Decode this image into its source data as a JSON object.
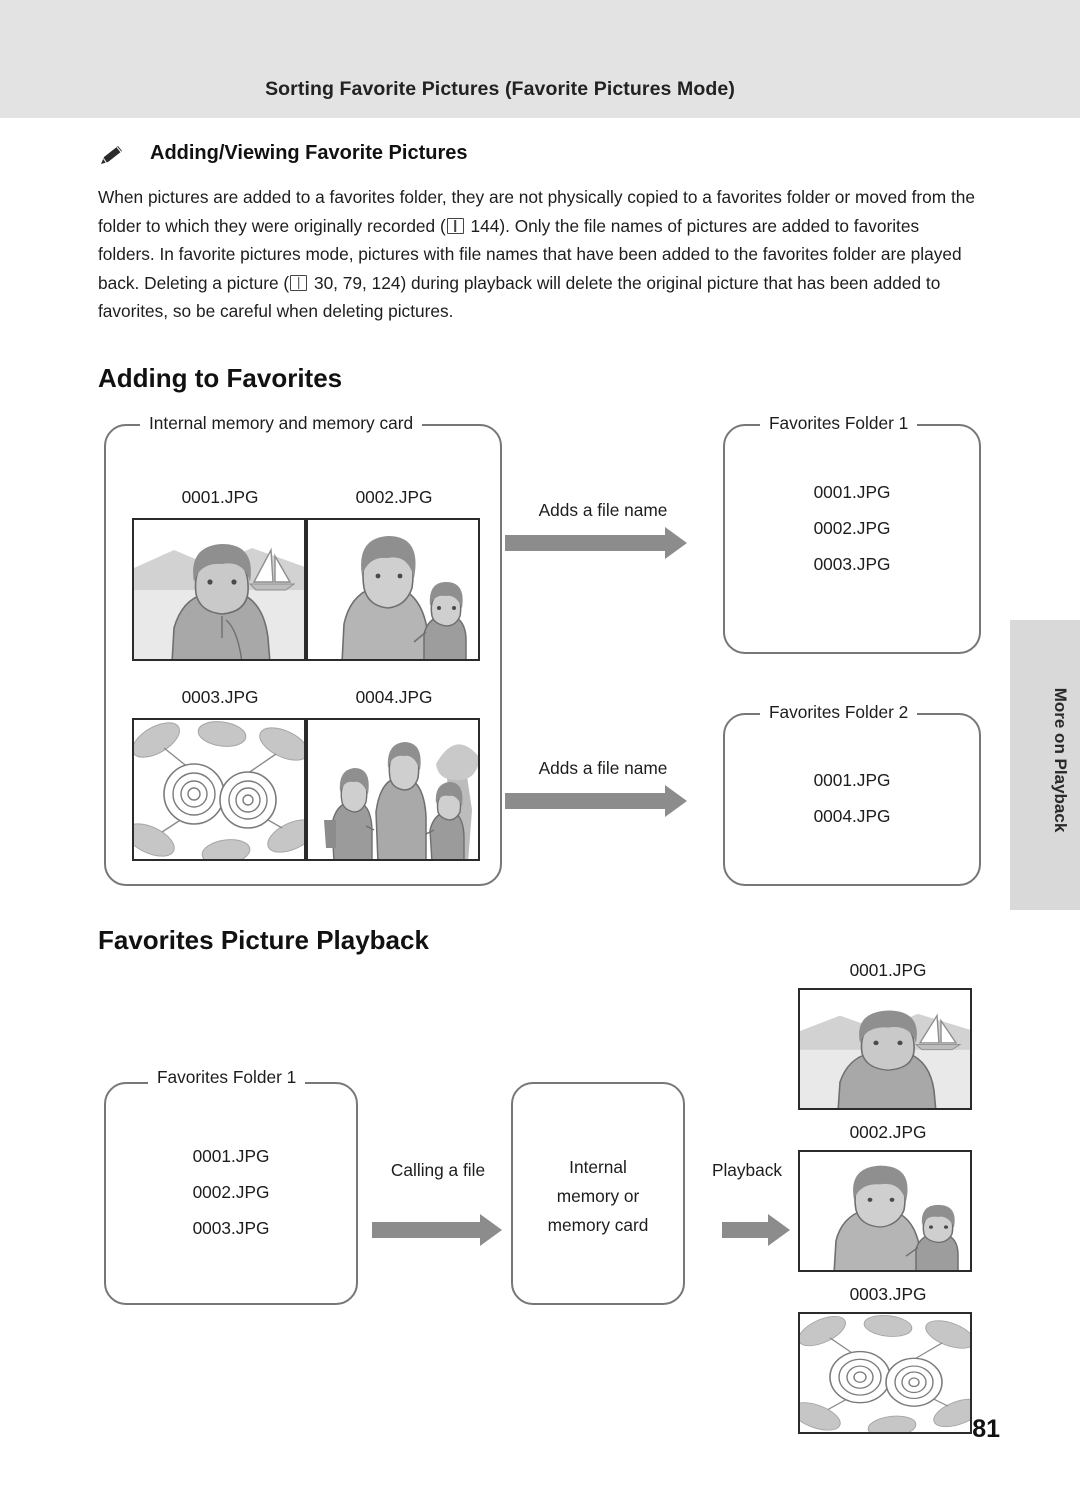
{
  "header": {
    "title": "Sorting Favorite Pictures (Favorite Pictures Mode)"
  },
  "side_tab": {
    "label": "More on Playback"
  },
  "note": {
    "icon": "pencil-note-icon",
    "title": "Adding/Viewing Favorite Pictures",
    "body_part1": "When pictures are added to a favorites folder, they are not physically copied to a favorites folder or moved from the folder to which they were originally recorded (",
    "body_ref1": " 144). Only the file names of pictures are added to favorites folders. In favorite pictures mode, pictures with file names that have been added to the favorites folder are played back. Deleting a picture (",
    "body_ref2": " 30, 79, 124) during playback will delete the original picture that has been added to favorites, so be careful when deleting pictures."
  },
  "sections": {
    "adding": "Adding to Favorites",
    "playback": "Favorites Picture Playback"
  },
  "adding_diagram": {
    "source_box_label": "Internal memory and memory card",
    "source_files": [
      "0001.JPG",
      "0002.JPG",
      "0003.JPG",
      "0004.JPG"
    ],
    "arrow1_caption": "Adds a file name",
    "arrow2_caption": "Adds a file name",
    "folder1_label": "Favorites Folder 1",
    "folder1_files": [
      "0001.JPG",
      "0002.JPG",
      "0003.JPG"
    ],
    "folder2_label": "Favorites Folder 2",
    "folder2_files": [
      "0001.JPG",
      "0004.JPG"
    ]
  },
  "playback_diagram": {
    "folder_label": "Favorites Folder 1",
    "folder_files": [
      "0001.JPG",
      "0002.JPG",
      "0003.JPG"
    ],
    "arrow1_caption": "Calling a file",
    "memory_box_label": "Internal\nmemory or\nmemory card",
    "arrow2_caption": "Playback",
    "output_files": [
      "0001.JPG",
      "0002.JPG",
      "0003.JPG"
    ]
  },
  "page_number": "81",
  "colors": {
    "header_band": "#e3e3e3",
    "side_tab": "#d9d9d9",
    "arrow": "#8c8c8c",
    "box_border": "#777777",
    "thumb_border": "#2b2b2b"
  }
}
